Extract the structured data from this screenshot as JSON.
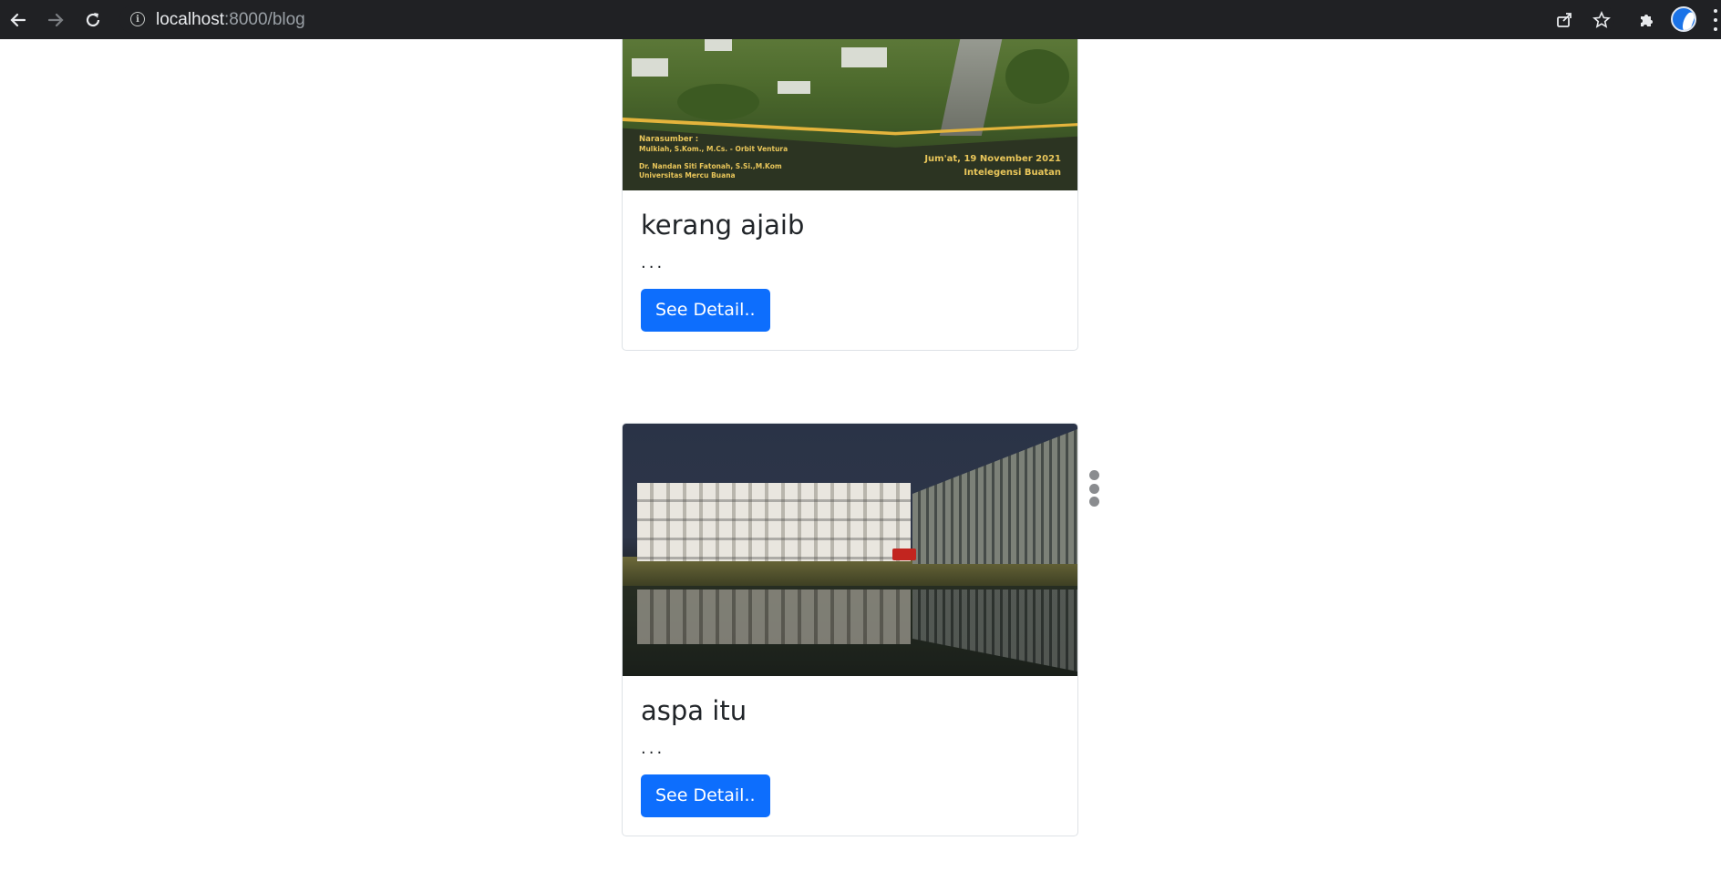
{
  "browser": {
    "url_host": "localhost",
    "url_path": ":8000/blog",
    "back_icon": "arrow-left-icon",
    "forward_icon": "arrow-right-icon",
    "reload_icon": "reload-icon",
    "info_icon": "info-icon",
    "share_icon": "share-icon",
    "bookmark_icon": "star-icon",
    "extensions_icon": "puzzle-icon",
    "profile_icon": "avatar-icon",
    "menu_icon": "kebab-icon"
  },
  "posts": [
    {
      "title": "kerang ajaib",
      "excerpt": "...",
      "button_label": "See Detail..",
      "image": {
        "narasumber_label": "Narasumber :",
        "speaker_1": "Mulkiah, S.Kom., M.Cs. - Orbit Ventura",
        "speaker_2": "Dr. Nandan Siti Fatonah, S.Si.,M.Kom",
        "speaker_2_org": "Universitas Mercu Buana",
        "date": "Jum'at, 19 November 2021",
        "topic": "Intelegensi Buatan"
      }
    },
    {
      "title": "aspa itu",
      "excerpt": "...",
      "button_label": "See Detail.."
    }
  ],
  "colors": {
    "primary": "#0d6efd",
    "chrome_bg": "#202124",
    "card_border": "#dee2e6"
  }
}
